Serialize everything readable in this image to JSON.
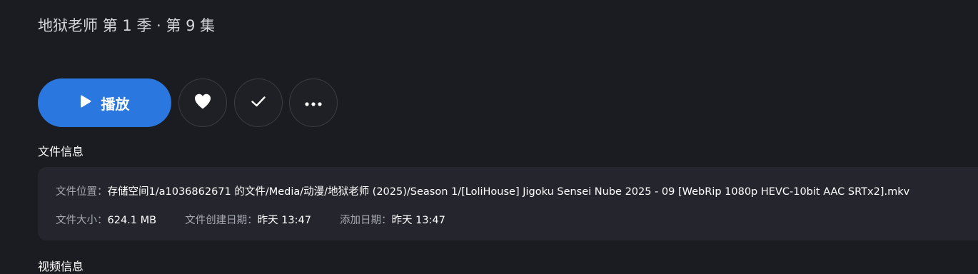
{
  "header": {
    "title": "地狱老师 第 1 季 · 第 9 集"
  },
  "actions": {
    "play_label": "播放",
    "favorite_icon": "heart-icon",
    "watched_icon": "check-icon",
    "more_icon": "more-horizontal-icon"
  },
  "file_info": {
    "section_title": "文件信息",
    "location_label": "文件位置：",
    "location_value": "存储空间1/a1036862671 的文件/Media/动漫/地狱老师 (2025)/Season 1/[LoliHouse] Jigoku Sensei Nube 2025 - 09 [WebRip 1080p HEVC-10bit AAC SRTx2].mkv",
    "size_label": "文件大小：",
    "size_value": "624.1 MB",
    "created_label": "文件创建日期：",
    "created_value": "昨天 13:47",
    "added_label": "添加日期：",
    "added_value": "昨天 13:47"
  },
  "video_info": {
    "section_title": "视频信息"
  },
  "colors": {
    "background": "#1b1c21",
    "accent": "#2a77df",
    "card": "#25262d"
  }
}
